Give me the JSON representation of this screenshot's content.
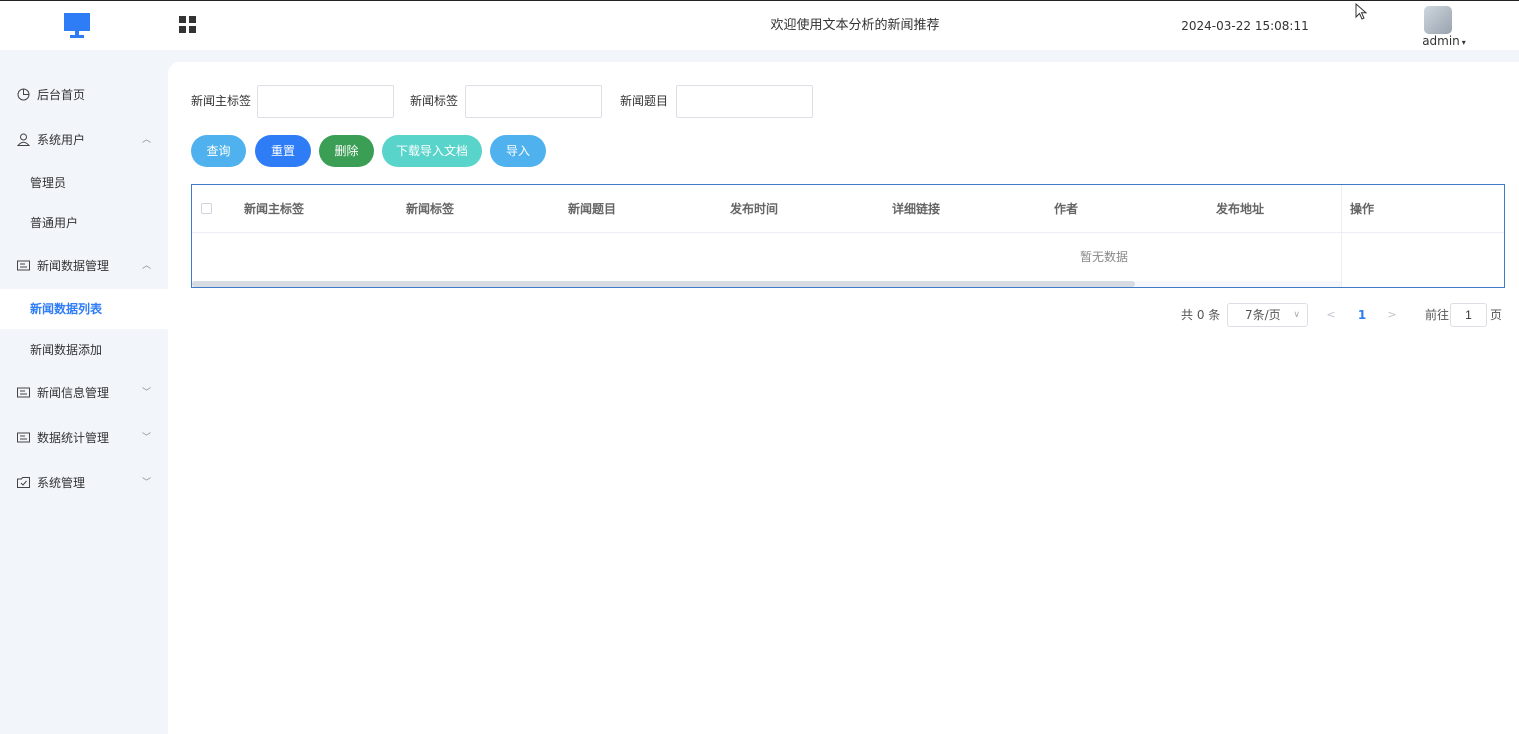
{
  "header": {
    "welcome": "欢迎使用文本分析的新闻推荐",
    "datetime": "2024-03-22 15:08:11",
    "username": "admin",
    "icons": {
      "logo": "monitor-logo",
      "grid": "grid-menu-icon",
      "cursor": "mouse-cursor-icon",
      "avatar": "user-avatar"
    }
  },
  "sidebar": {
    "items": [
      {
        "label": "后台首页",
        "icon": "dashboard-icon",
        "arrow": ""
      },
      {
        "label": "系统用户",
        "icon": "user-icon",
        "arrow": "^"
      },
      {
        "label": "管理员"
      },
      {
        "label": "普通用户"
      },
      {
        "label": "新闻数据管理",
        "icon": "news-icon",
        "arrow": "^"
      },
      {
        "label": "新闻数据列表",
        "active": true
      },
      {
        "label": "新闻数据添加"
      },
      {
        "label": "新闻信息管理",
        "icon": "news-icon",
        "arrow": "v"
      },
      {
        "label": "数据统计管理",
        "icon": "news-icon",
        "arrow": "v"
      },
      {
        "label": "系统管理",
        "icon": "settings-box-icon",
        "arrow": "v"
      }
    ]
  },
  "filters": {
    "main_tag_label": "新闻主标签",
    "tag_label": "新闻标签",
    "title_label": "新闻题目",
    "main_tag_value": "",
    "tag_value": "",
    "title_value": ""
  },
  "buttons": {
    "search": "查询",
    "reset": "重置",
    "delete": "删除",
    "download": "下载导入文档",
    "import": "导入"
  },
  "table": {
    "columns": [
      "新闻主标签",
      "新闻标签",
      "新闻题目",
      "发布时间",
      "详细链接",
      "作者",
      "发布地址",
      "操作"
    ],
    "empty_text": "暂无数据"
  },
  "pagination": {
    "total_text": "共 0 条",
    "page_size": "7条/页",
    "current_page": "1",
    "goto_label": "前往",
    "goto_value": "1",
    "page_suffix": "页"
  },
  "colors": {
    "primary": "#2f7df6",
    "info": "#4fb2ee",
    "success": "#3b9e55",
    "teal": "#59d4cb"
  }
}
